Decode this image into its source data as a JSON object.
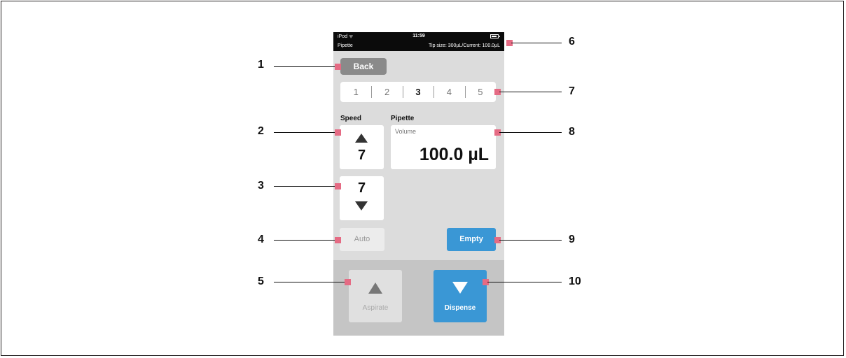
{
  "status_bar": {
    "carrier": "iPod ᯤ",
    "time": "11:59",
    "app_name": "Pipette",
    "tip_info": "Tip size:  300µL/Current:  100.0µL"
  },
  "back_button": "Back",
  "tabs": [
    {
      "label": "1"
    },
    {
      "label": "2"
    },
    {
      "label": "3",
      "active": true
    },
    {
      "label": "4"
    },
    {
      "label": "5"
    }
  ],
  "speed": {
    "label": "Speed",
    "up_value": "7",
    "down_value": "7"
  },
  "pipette": {
    "label": "Pipette",
    "volume_label": "Volume",
    "volume_value": "100.0 µL"
  },
  "auto_button": "Auto",
  "empty_button": "Empty",
  "aspirate_button": "Aspirate",
  "dispense_button": "Dispense",
  "callouts": [
    "1",
    "2",
    "3",
    "4",
    "5",
    "6",
    "7",
    "8",
    "9",
    "10"
  ],
  "colors": {
    "accent_blue": "#3a97d5",
    "callout_marker": "#e56b84",
    "status_bar": "#0b0b0b"
  }
}
